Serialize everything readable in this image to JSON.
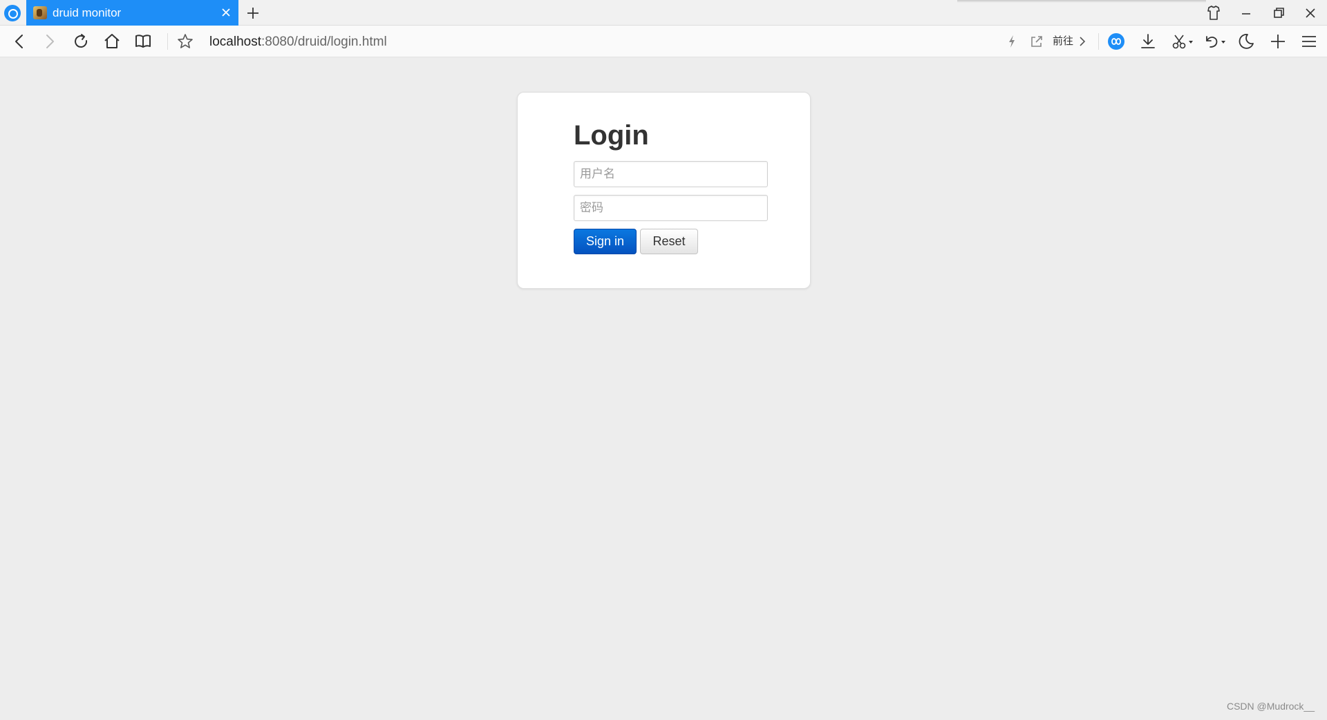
{
  "tab": {
    "title": "druid monitor"
  },
  "toolbar": {
    "url_host": "localhost",
    "url_path": ":8080/druid/login.html",
    "goto_label": "前往"
  },
  "icons": {
    "browser": "qq-browser-logo-icon",
    "favicon": "druid-favicon-icon",
    "back": "back-arrow-icon",
    "forward": "forward-arrow-icon",
    "refresh": "refresh-icon",
    "home": "home-icon",
    "reader": "book-icon",
    "bookmark": "star-icon",
    "flash": "lightning-icon",
    "share": "share-icon",
    "extension": "infinity-icon",
    "download": "download-icon",
    "screenshot": "scissors-icon",
    "undo": "undo-icon",
    "night": "moon-icon",
    "add": "plus-icon",
    "menu": "hamburger-icon"
  },
  "colors": {
    "tab_active": "#1e8ef7",
    "page_background": "#ededed",
    "signin_button": "#0452bf"
  },
  "login": {
    "title": "Login",
    "username_placeholder": "用户名",
    "password_placeholder": "密码",
    "signin_label": "Sign in",
    "reset_label": "Reset"
  },
  "watermark": "CSDN @Mudrock__"
}
